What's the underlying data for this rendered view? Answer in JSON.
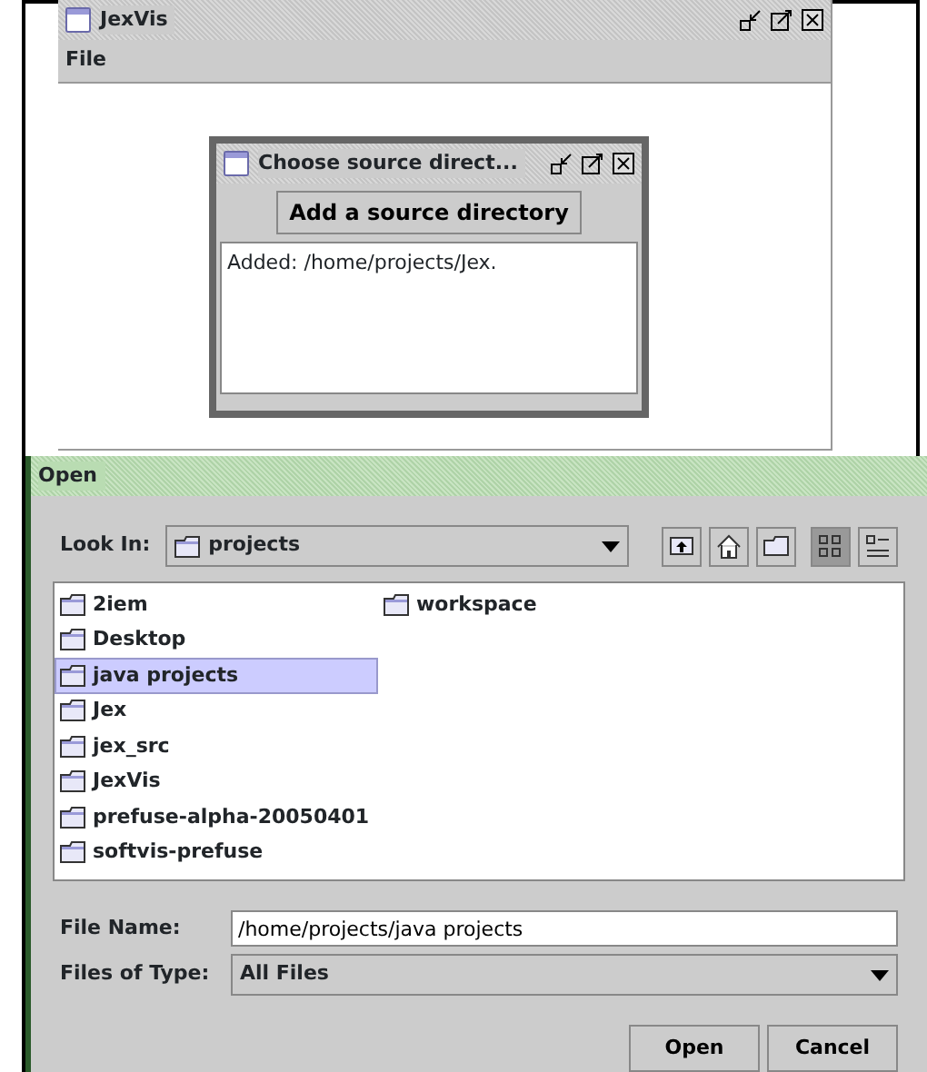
{
  "main_window": {
    "title": "JexVis",
    "menu": [
      "File"
    ]
  },
  "source_dialog": {
    "title": "Choose source direct...",
    "button": "Add a source directory",
    "log": "Added: /home/projects/Jex."
  },
  "open_dialog": {
    "title": "Open",
    "look_in": {
      "label": "Look In:",
      "value": "projects"
    },
    "toolbar": [
      {
        "kind": "up",
        "selected": false
      },
      {
        "kind": "home",
        "selected": false
      },
      {
        "kind": "newfolder",
        "selected": false
      },
      {
        "kind": "list",
        "selected": true
      },
      {
        "kind": "details",
        "selected": false
      }
    ],
    "files": [
      {
        "name": "2iem",
        "selected": false
      },
      {
        "name": "Desktop",
        "selected": false
      },
      {
        "name": "java projects",
        "selected": true
      },
      {
        "name": "Jex",
        "selected": false
      },
      {
        "name": "jex_src",
        "selected": false
      },
      {
        "name": "JexVis",
        "selected": false
      },
      {
        "name": "prefuse-alpha-20050401",
        "selected": false
      },
      {
        "name": "softvis-prefuse",
        "selected": false
      },
      {
        "name": "workspace",
        "selected": false
      }
    ],
    "file_name": {
      "label": "File Name:",
      "value": "/home/projects/java projects"
    },
    "file_type": {
      "label": "Files of Type:",
      "value": "All Files"
    },
    "buttons": [
      "Open",
      "Cancel"
    ]
  }
}
